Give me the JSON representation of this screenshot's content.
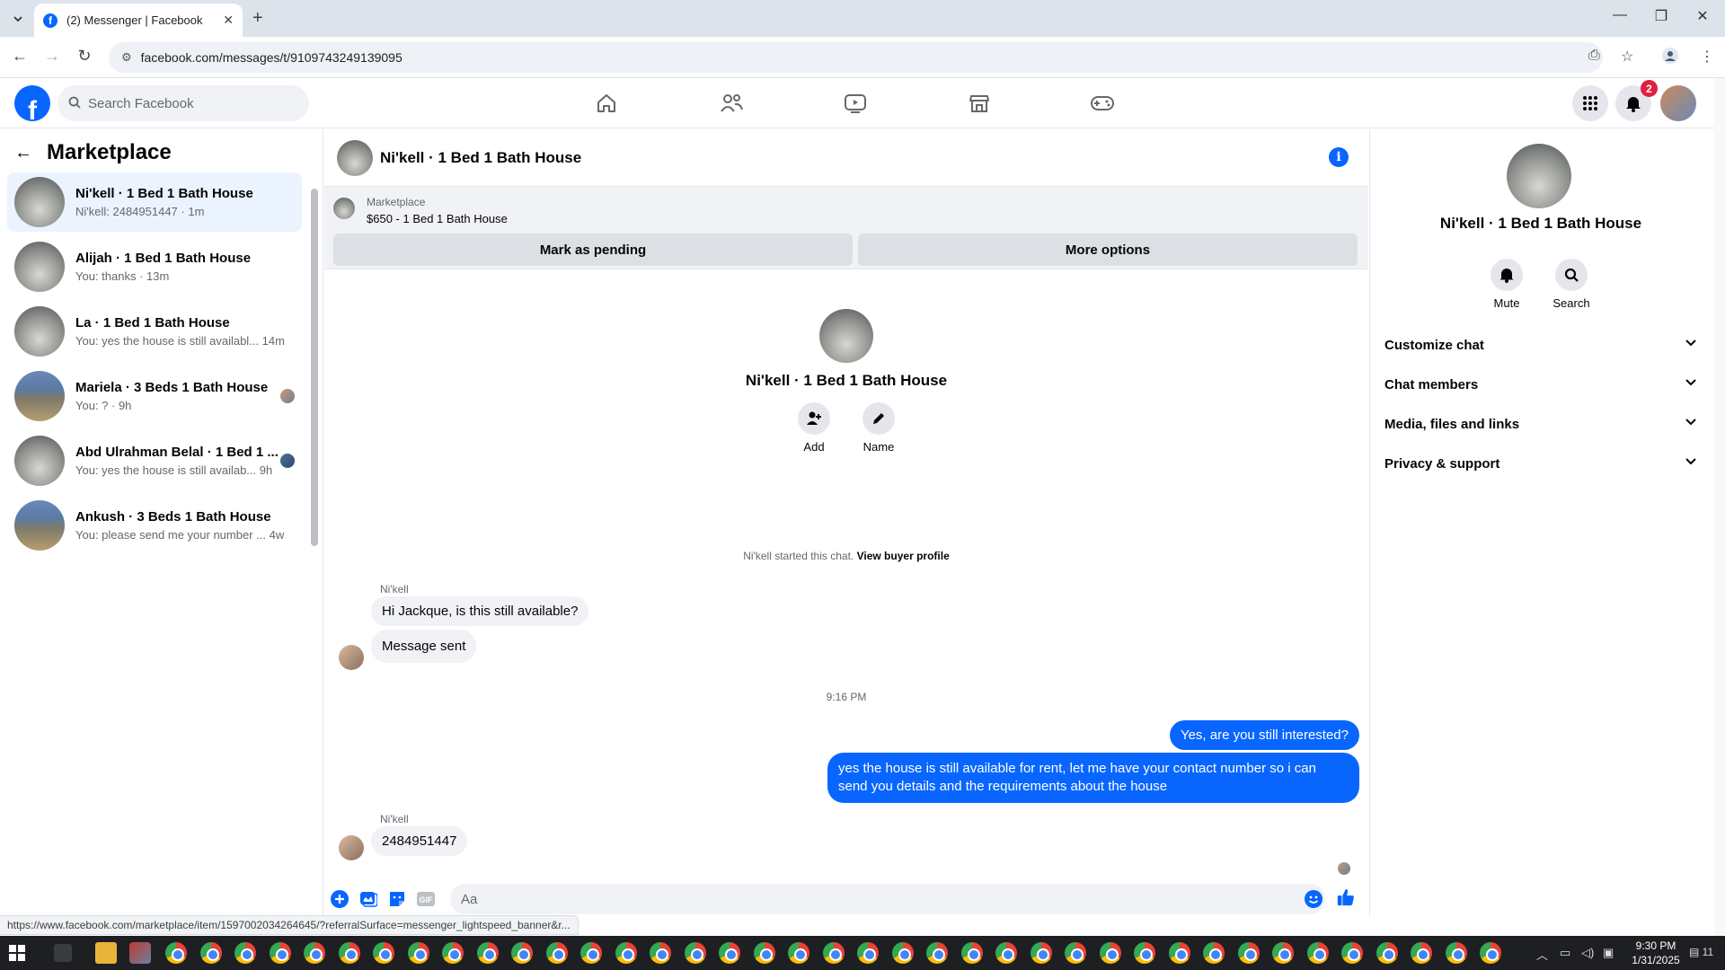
{
  "browser": {
    "tab_title": "(2) Messenger | Facebook",
    "url": "facebook.com/messages/t/9109743249139095",
    "status_link": "https://www.facebook.com/marketplace/item/1597002034264645/?referralSurface=messenger_lightspeed_banner&r..."
  },
  "header": {
    "search_placeholder": "Search Facebook",
    "notification_count": "2"
  },
  "sidebar": {
    "title": "Marketplace",
    "conversations": [
      {
        "name": "Ni'kell · 1 Bed 1 Bath House",
        "snippet": "Ni'kell: 2484951447 · 1m"
      },
      {
        "name": "Alijah · 1 Bed 1 Bath House",
        "snippet": "You: thanks · 13m"
      },
      {
        "name": "La · 1 Bed 1 Bath House",
        "snippet": "You: yes the house is still availabl... 14m"
      },
      {
        "name": "Mariela · 3 Beds 1 Bath House",
        "snippet": "You: ? · 9h"
      },
      {
        "name": "Abd Ulrahman Belal · 1 Bed 1 ...",
        "snippet": "You: yes the house is still availab... 9h"
      },
      {
        "name": "Ankush · 3 Beds 1 Bath House",
        "snippet": "You: please send me your number ... 4w"
      }
    ]
  },
  "chat": {
    "title": "Ni'kell · 1 Bed 1 Bath House",
    "listing": {
      "label": "Marketplace",
      "price_title": "$650 - 1 Bed 1 Bath House",
      "mark_pending": "Mark as pending",
      "more_options": "More options"
    },
    "intro": {
      "name": "Ni'kell · 1 Bed 1 Bath House",
      "add_label": "Add",
      "name_label": "Name"
    },
    "started_text": "Ni'kell started this chat.",
    "view_profile": "View buyer profile",
    "messages": {
      "sender1": "Ni'kell",
      "m1": "Hi Jackque, is this still available?",
      "m2": "Message sent",
      "time": "9:16 PM",
      "m3": "Yes, are you still interested?",
      "m4": "yes the house is still available for rent, let me have your contact number so i can send you details and the requirements about the house",
      "sender2": "Ni'kell",
      "m5": "2484951447"
    },
    "composer_placeholder": "Aa"
  },
  "info_panel": {
    "name": "Ni'kell · 1 Bed 1 Bath House",
    "mute": "Mute",
    "search": "Search",
    "sections": [
      "Customize chat",
      "Chat members",
      "Media, files and links",
      "Privacy & support"
    ]
  },
  "taskbar": {
    "time": "9:30 PM",
    "date": "1/31/2025",
    "notif_count": "11"
  },
  "colors": {
    "brand": "#0866ff",
    "active_row": "#ebf3ff",
    "bubble_in": "#f0f2f5",
    "badge": "#e41e3f"
  }
}
